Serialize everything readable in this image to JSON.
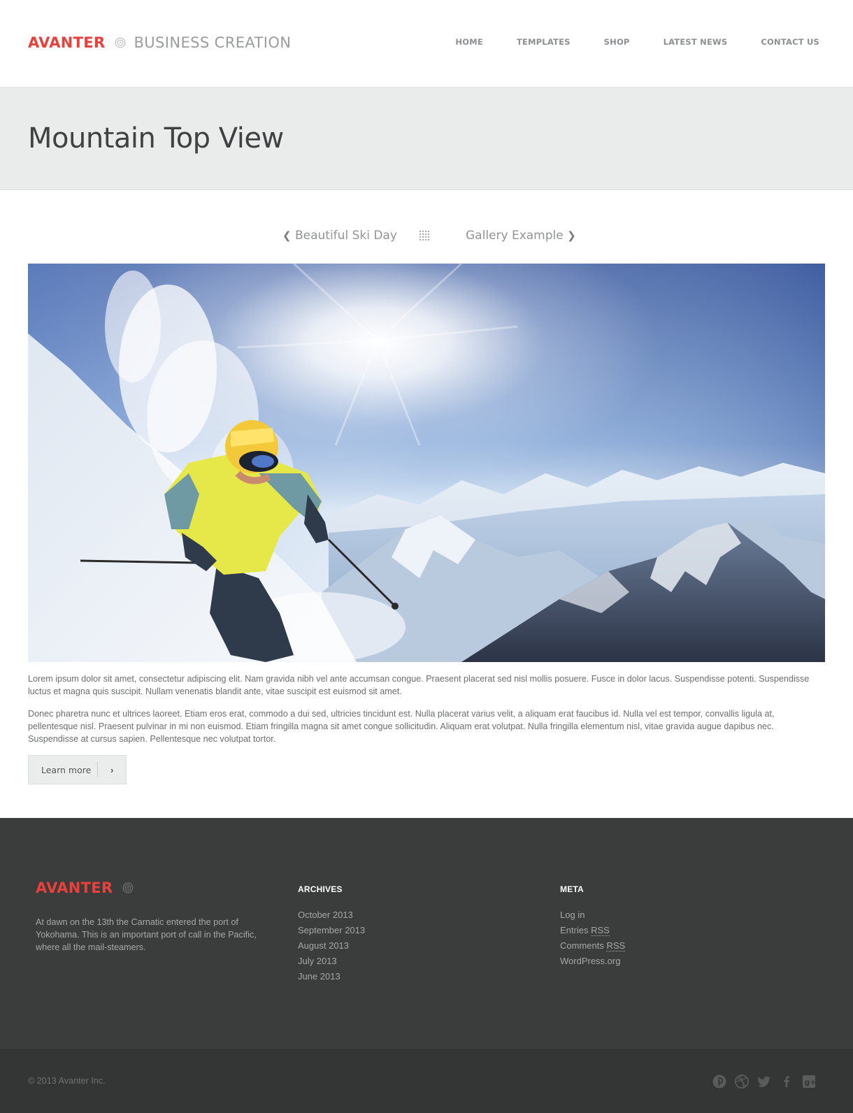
{
  "header": {
    "brand": "AVANTER",
    "tagline": "BUSINESS CREATION",
    "nav": [
      "HOME",
      "TEMPLATES",
      "SHOP",
      "LATEST NEWS",
      "CONTACT US"
    ]
  },
  "page": {
    "title": "Mountain Top View"
  },
  "post_nav": {
    "prev_label": "Beautiful Ski Day",
    "next_label": "Gallery Example",
    "prev_chevron": "❮",
    "next_chevron": "❯"
  },
  "content": {
    "paragraphs": [
      "Lorem ipsum dolor sit amet, consectetur adipiscing elit. Nam gravida nibh vel ante accumsan congue. Praesent placerat sed nisl mollis posuere. Fusce in dolor lacus. Suspendisse potenti. Suspendisse luctus et magna quis suscipit. Nullam venenatis blandit ante, vitae suscipit est euismod sit amet.",
      "Donec pharetra nunc et ultrices laoreet. Etiam eros erat, commodo a dui sed, ultricies tincidunt est. Nulla placerat varius velit, a aliquam erat faucibus id. Nulla vel est tempor, convallis ligula at, pellentesque nisl. Praesent pulvinar in mi non euismod. Etiam fringilla magna sit amet congue sollicitudin. Aliquam erat volutpat. Nulla fringilla elementum nisl, vitae gravida augue dapibus nec. Suspendisse at cursus sapien. Pellentesque nec volutpat tortor."
    ],
    "learn_more_label": "Learn more",
    "learn_more_arrow": "›"
  },
  "footer": {
    "brand": "AVANTER",
    "about": "At dawn on the 13th the Carnatic entered the port of Yokohama. This is an important port of call in the Pacific, where all the mail-steamers.",
    "archives": {
      "heading": "ARCHIVES",
      "items": [
        "October 2013",
        "September 2013",
        "August 2013",
        "July 2013",
        "June 2013"
      ]
    },
    "meta": {
      "heading": "META",
      "log_in": "Log in",
      "entries_prefix": "Entries ",
      "comments_prefix": "Comments ",
      "rss": "RSS",
      "wordpress": "WordPress.org"
    },
    "copyright": "© 2013 Avanter Inc.",
    "social_icons": [
      "pinterest-icon",
      "dribbble-icon",
      "twitter-icon",
      "facebook-icon",
      "google-plus-icon"
    ]
  },
  "colors": {
    "accent": "#e8413b",
    "title_band": "#e9eceb",
    "footer": "#3b3c3c",
    "bottom_bar": "#343535"
  }
}
